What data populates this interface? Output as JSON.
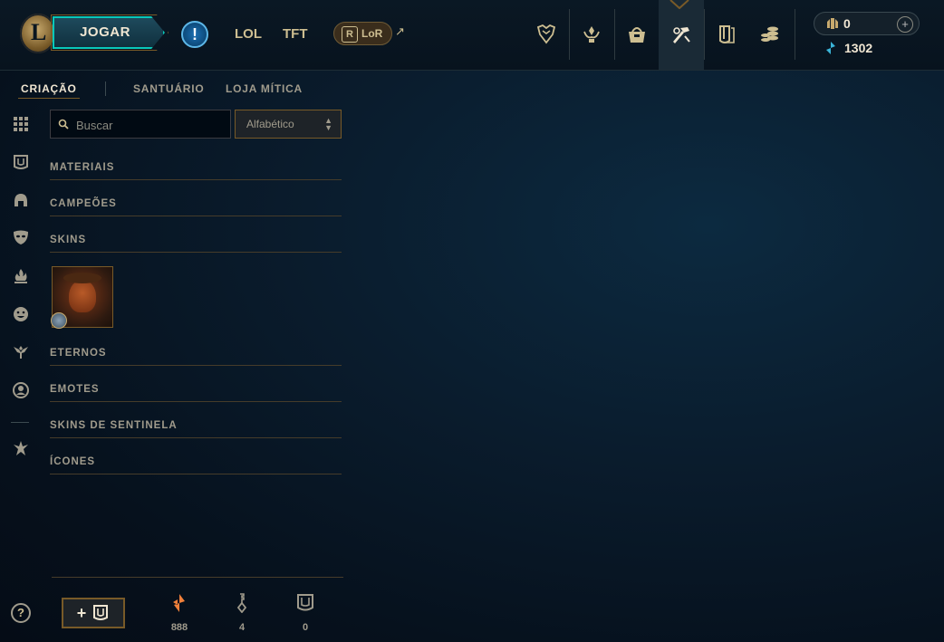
{
  "topbar": {
    "play_label": "JOGAR",
    "tabs": [
      "LOL",
      "TFT"
    ],
    "lor_label": "LoR",
    "lor_external": "↗",
    "alert_symbol": "!",
    "nav_icons": [
      "trophy-icon",
      "honor-icon",
      "collection-bag-icon",
      "crafting-icon",
      "loot-icon",
      "store-coins-icon"
    ]
  },
  "wallet": {
    "rp": "0",
    "blue_essence": "1302",
    "add_symbol": "+"
  },
  "subnav": {
    "tabs": [
      "CRIAÇÃO",
      "SANTUÁRIO",
      "LOJA MÍTICA"
    ],
    "active": "CRIAÇÃO"
  },
  "sidebar_icons": [
    "all-grid-icon",
    "chest-icon",
    "helmet-icon",
    "mask-icon",
    "flame-icon",
    "emote-icon",
    "ward-icon",
    "profile-icon",
    "eternals-icon"
  ],
  "filters": {
    "search_placeholder": "Buscar",
    "sort_value": "Alfabético"
  },
  "categories": [
    "MATERIAIS",
    "CAMPEÕES",
    "SKINS",
    "ETERNOS",
    "EMOTES",
    "SKINS DE SENTINELA",
    "ÍCONES"
  ],
  "footer": {
    "help_symbol": "?",
    "add_chest_symbol": "+",
    "resources": [
      {
        "name": "orange-essence",
        "count": "888"
      },
      {
        "name": "key",
        "count": "4"
      },
      {
        "name": "chest",
        "count": "0"
      }
    ]
  },
  "colors": {
    "gold": "#c8aa6e",
    "teal": "#0ac8b9",
    "text": "#a09b8c",
    "orange_essence": "#f0803a",
    "blue_essence": "#3ab4d8"
  }
}
